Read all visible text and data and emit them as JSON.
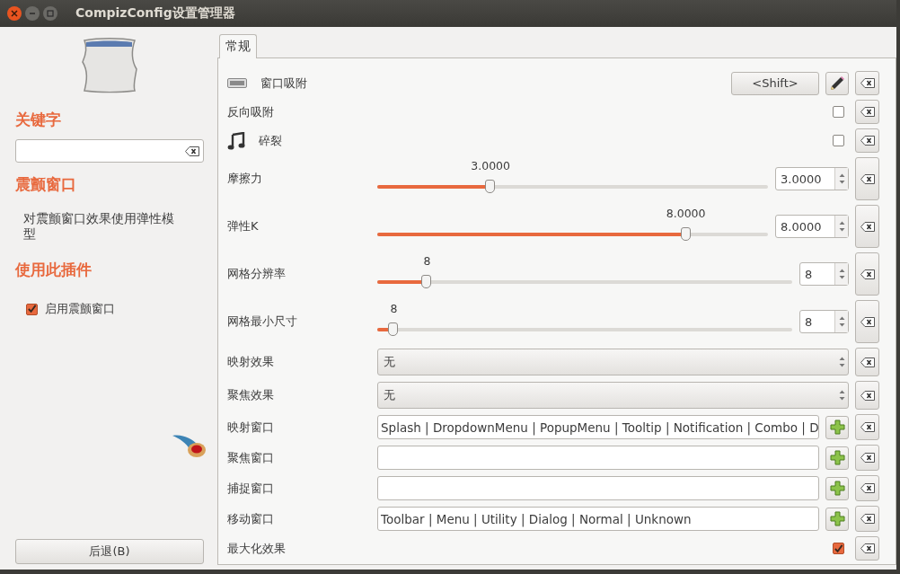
{
  "window": {
    "title": "CompizConfig设置管理器"
  },
  "sidebar": {
    "filter_heading": "关键字",
    "plugin_title": "震颤窗口",
    "plugin_description": "对震颤窗口效果使用弹性模型",
    "enable_heading": "使用此插件",
    "enable": {
      "label": "启用震颤窗口",
      "checked": true
    },
    "back_button": "后退(B)"
  },
  "tabs": [
    {
      "label": "常规",
      "selected": true
    }
  ],
  "settings": [
    {
      "kind": "key",
      "label": "窗口吸附",
      "value": "<Shift>"
    },
    {
      "kind": "check",
      "label": "反向吸附",
      "checked": false
    },
    {
      "kind": "sound_check",
      "label": "碎裂",
      "checked": false
    },
    {
      "kind": "slider",
      "label": "摩擦力",
      "reading": "3.0000",
      "level": 0.29,
      "value": "3.0000"
    },
    {
      "kind": "slider",
      "label": "弹性K",
      "reading": "8.0000",
      "level": 0.79,
      "value": "8.0000"
    },
    {
      "kind": "int_slider",
      "label": "网格分辨率",
      "reading": "8",
      "level": 0.12,
      "value": "8"
    },
    {
      "kind": "int_slider",
      "label": "网格最小尺寸",
      "reading": "8",
      "level": 0.04,
      "value": "8"
    },
    {
      "kind": "combo",
      "label": "映射效果",
      "value": "无"
    },
    {
      "kind": "combo",
      "label": "聚焦效果",
      "value": "无"
    },
    {
      "kind": "list",
      "label": "映射窗口",
      "value": "Splash | DropdownMenu | PopupMenu | Tooltip | Notification | Combo | D"
    },
    {
      "kind": "list",
      "label": "聚焦窗口"
    },
    {
      "kind": "list",
      "label": "捕捉窗口"
    },
    {
      "kind": "list",
      "label": "移动窗口",
      "value": "Toolbar | Menu | Utility | Dialog | Normal | Unknown"
    },
    {
      "kind": "check",
      "label": "最大化效果",
      "checked": true
    }
  ]
}
